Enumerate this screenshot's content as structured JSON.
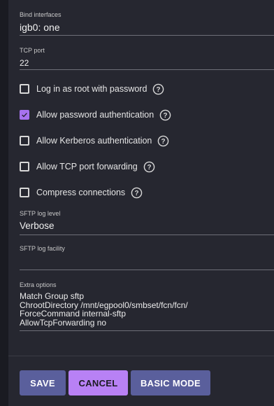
{
  "fields": {
    "bind_interfaces": {
      "label": "Bind interfaces",
      "value": "igb0: one"
    },
    "tcp_port": {
      "label": "TCP port",
      "value": "22"
    },
    "sftp_log_level": {
      "label": "SFTP log level",
      "value": "Verbose"
    },
    "sftp_log_facility": {
      "label": "SFTP log facility",
      "value": ""
    },
    "extra_options": {
      "label": "Extra options",
      "lines": [
        "Match Group sftp",
        "ChrootDirectory /mnt/egpool0/smbset/fcn/fcn/",
        "ForceCommand internal-sftp",
        "AllowTcpForwarding no"
      ]
    }
  },
  "checkboxes": [
    {
      "label": "Log in as root with password",
      "checked": false
    },
    {
      "label": "Allow password authentication",
      "checked": true
    },
    {
      "label": "Allow Kerberos authentication",
      "checked": false
    },
    {
      "label": "Allow TCP port forwarding",
      "checked": false
    },
    {
      "label": "Compress connections",
      "checked": false
    }
  ],
  "buttons": {
    "save": "SAVE",
    "cancel": "CANCEL",
    "basic_mode": "BASIC MODE"
  },
  "colors": {
    "accent": "#a772ee",
    "primary_button": "#5a5f9c",
    "background": "#262730"
  },
  "icons": {
    "help": "help-circle-icon",
    "check": "check-icon"
  }
}
